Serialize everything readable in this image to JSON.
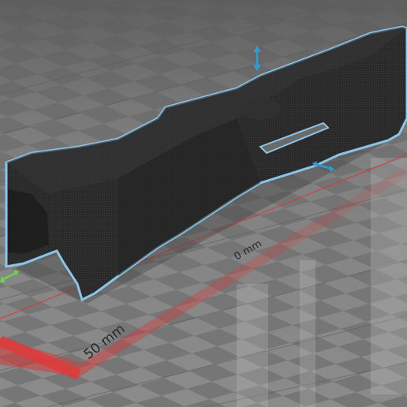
{
  "viewport": {
    "scale_labels": {
      "near": "50 mm",
      "far": "0 mm"
    }
  },
  "colors": {
    "floor_light": "#8a8a8a",
    "floor_dark": "#757575",
    "grid_line": "#5f5f5f",
    "axis_red": "#d83a3a",
    "model_body": "#2b2b2b",
    "model_outline": "#7ab8e0",
    "handle_blue": "#2e9bd9",
    "handle_green": "#6fd44a"
  },
  "handles": [
    {
      "name": "vertical-scale-handle",
      "axis": "z"
    },
    {
      "name": "horizontal-scale-handle",
      "axis": "x"
    },
    {
      "name": "depth-scale-handle",
      "axis": "y"
    }
  ]
}
